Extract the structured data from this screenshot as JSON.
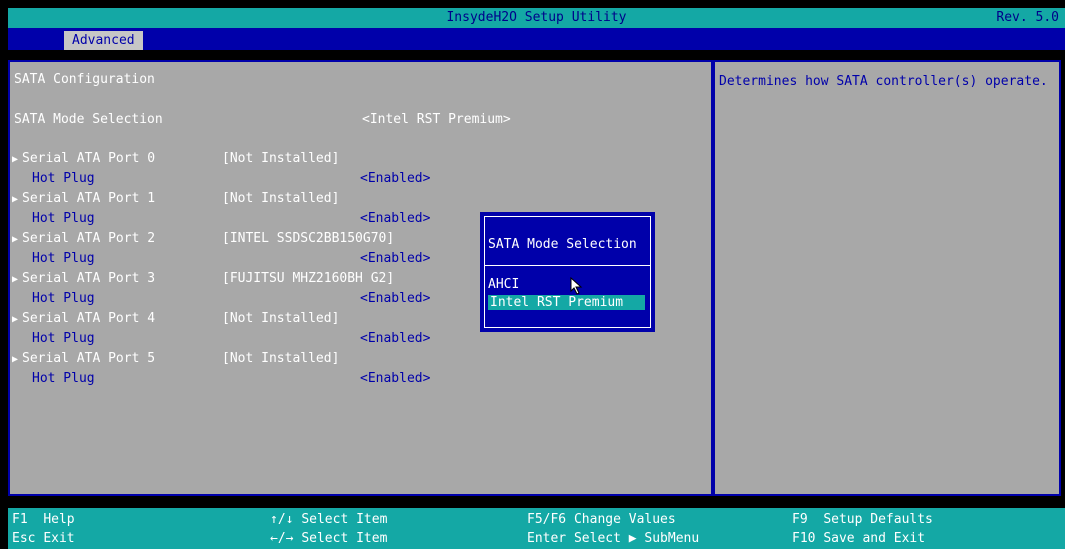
{
  "header": {
    "title": "InsydeH2O Setup Utility",
    "revision": "Rev. 5.0",
    "active_tab": "Advanced"
  },
  "main": {
    "section_title": "SATA Configuration",
    "sata_mode": {
      "label": "SATA Mode Selection",
      "value": "<Intel RST Premium>"
    },
    "ports": [
      {
        "label": "Serial ATA Port 0",
        "device": "[Not Installed]",
        "hotplug_label": "Hot Plug",
        "hotplug_value": "<Enabled>"
      },
      {
        "label": "Serial ATA Port 1",
        "device": "[Not Installed]",
        "hotplug_label": "Hot Plug",
        "hotplug_value": "<Enabled>"
      },
      {
        "label": "Serial ATA Port 2",
        "device": "[INTEL SSDSC2BB150G70]",
        "hotplug_label": "Hot Plug",
        "hotplug_value": "<Enabled>"
      },
      {
        "label": "Serial ATA Port 3",
        "device": "[FUJITSU MHZ2160BH G2]",
        "hotplug_label": "Hot Plug",
        "hotplug_value": "<Enabled>"
      },
      {
        "label": "Serial ATA Port 4",
        "device": "[Not Installed]",
        "hotplug_label": "Hot Plug",
        "hotplug_value": "<Enabled>"
      },
      {
        "label": "Serial ATA Port 5",
        "device": "[Not Installed]",
        "hotplug_label": "Hot Plug",
        "hotplug_value": "<Enabled>"
      }
    ]
  },
  "help": {
    "text": "Determines how SATA controller(s) operate."
  },
  "popup": {
    "title": "SATA Mode Selection",
    "options": [
      "AHCI",
      "Intel RST Premium"
    ],
    "selected": "Intel RST Premium"
  },
  "footer": {
    "f1_key": "F1",
    "f1_label": "Help",
    "esc_key": "Esc",
    "esc_label": "Exit",
    "updown_key": "↑/↓",
    "updown_label": "Select Item",
    "leftright_key": "←/→",
    "leftright_label": "Select Item",
    "f5f6_key": "F5/F6",
    "f5f6_label": "Change Values",
    "enter_key": "Enter",
    "enter_label": "Select ▶ SubMenu",
    "f9_key": "F9",
    "f9_label": "Setup Defaults",
    "f10_key": "F10",
    "f10_label": "Save and Exit"
  },
  "colors": {
    "title_bar": "#14a8a5",
    "tab_bar": "#0000aa",
    "panel": "#a8a8a8",
    "highlight": "#14a8a5"
  }
}
